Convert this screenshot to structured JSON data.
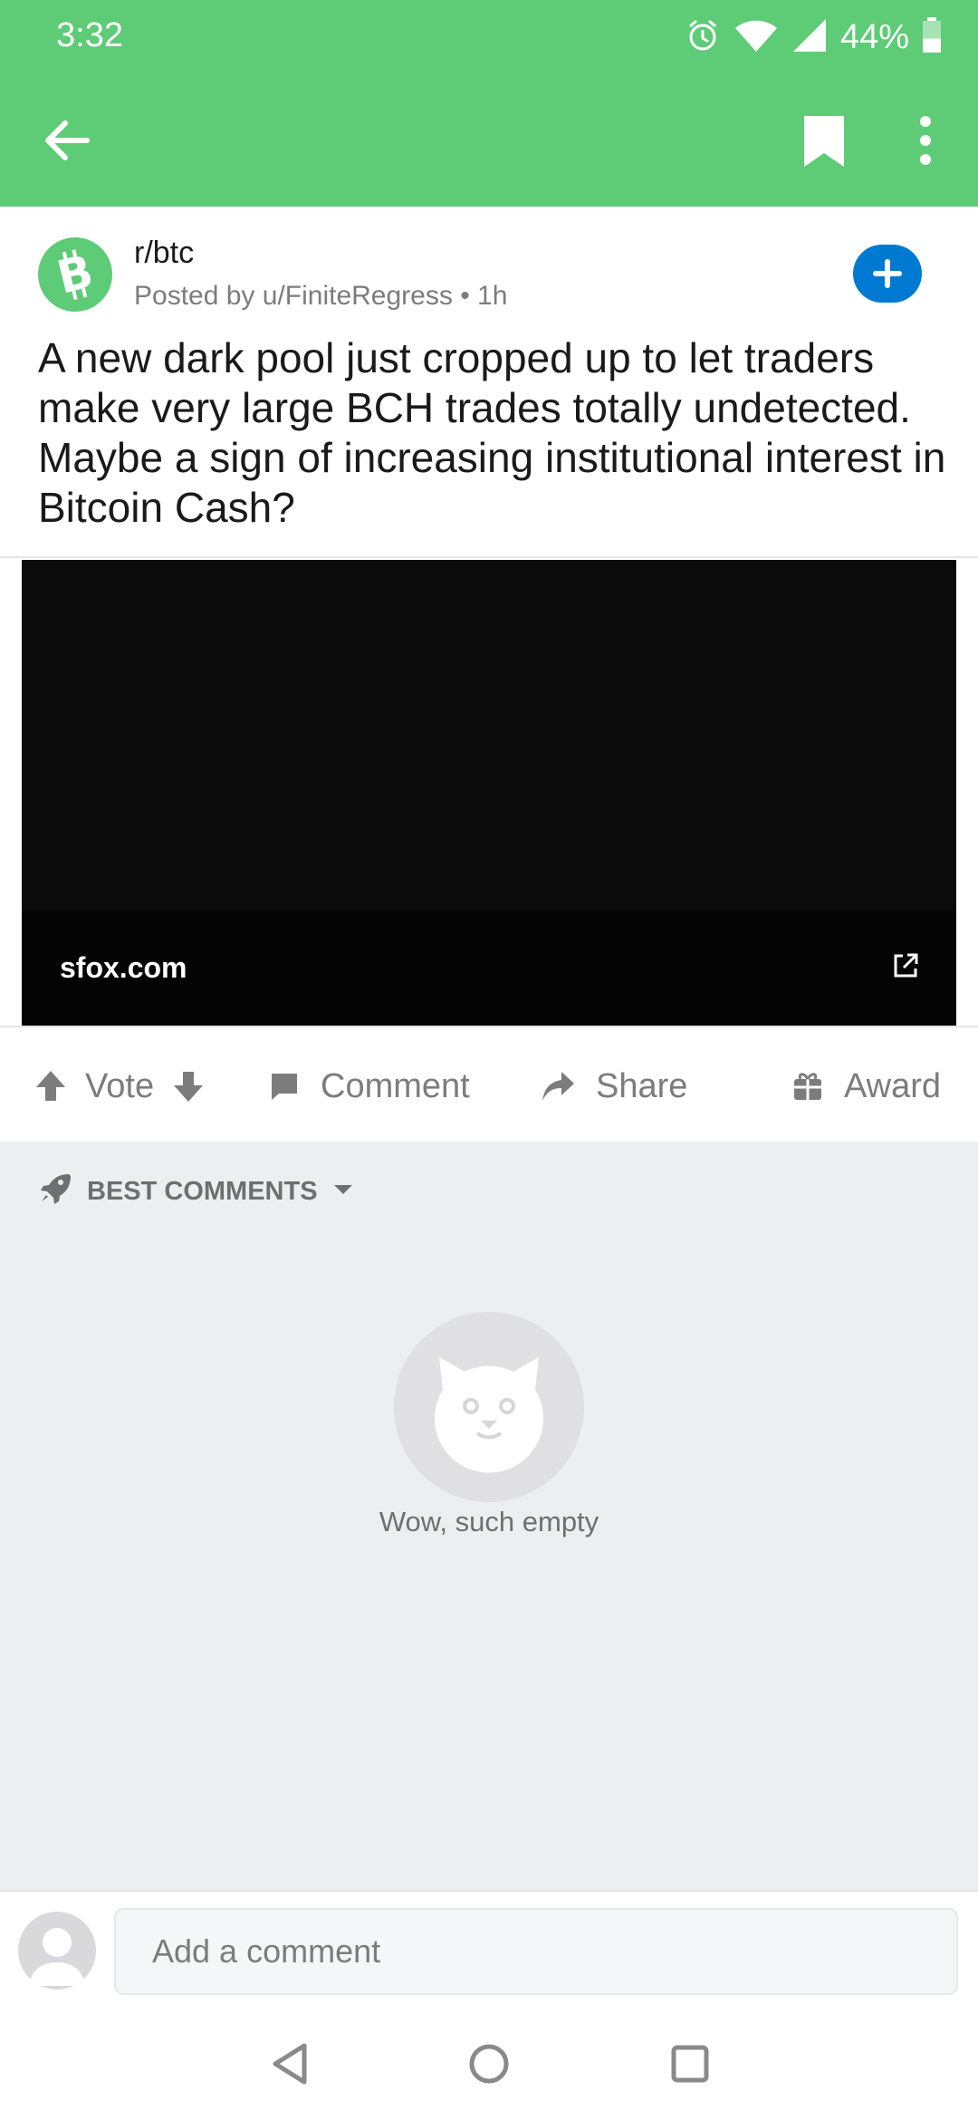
{
  "status_bar": {
    "time": "3:32",
    "battery_percent": "44%",
    "battery_level": 0.44,
    "icons": [
      "alarm-icon",
      "wifi-icon",
      "cell-signal-icon",
      "battery-icon"
    ]
  },
  "app_bar": {
    "icons": [
      "back-arrow-icon",
      "bookmark-icon",
      "more-vert-icon"
    ],
    "accent_color": "#5ecb77"
  },
  "post": {
    "subreddit": "r/btc",
    "posted_by": "Posted by u/FiniteRegress",
    "age": "• 1h",
    "title": "A new dark pool just cropped up to let traders make very large BCH trades totally undetected. Maybe a sign of increasing institutional interest in Bitcoin Cash?",
    "link_domain": "sfox.com",
    "join_color": "#0079d3"
  },
  "actions": {
    "vote_label": "Vote",
    "comment_label": "Comment",
    "share_label": "Share",
    "award_label": "Award"
  },
  "comments": {
    "sort_label": "BEST COMMENTS",
    "empty_text": "Wow, such empty"
  },
  "comment_bar": {
    "placeholder": "Add a comment"
  },
  "nav_bar": {
    "icons": [
      "nav-back-icon",
      "nav-home-icon",
      "nav-recents-icon"
    ]
  }
}
